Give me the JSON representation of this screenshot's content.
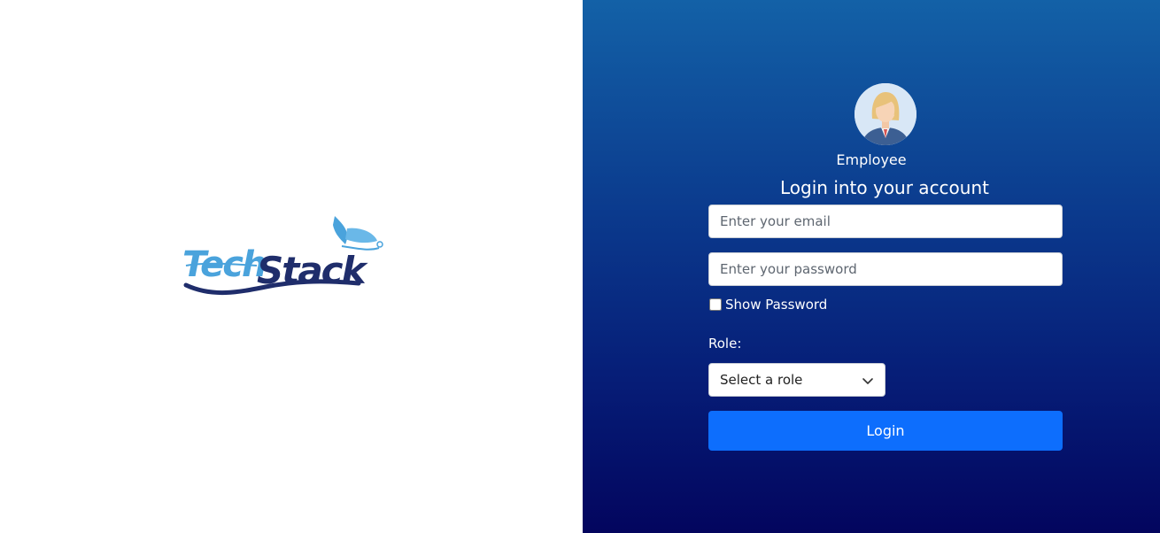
{
  "brand": {
    "logo_text": "TechStack"
  },
  "login": {
    "role_caption": "Employee",
    "heading": "Login into your account",
    "email_placeholder": "Enter your email",
    "password_placeholder": "Enter your password",
    "show_password_label": "Show Password",
    "role_label": "Role:",
    "role_select_value": "Select a role",
    "login_button": "Login"
  },
  "colors": {
    "panel_gradient_top": "#1361a7",
    "panel_gradient_bottom": "#03055e",
    "button": "#0d6efd",
    "logo_light": "#4aa3dc",
    "logo_dark": "#1f2d6b"
  }
}
